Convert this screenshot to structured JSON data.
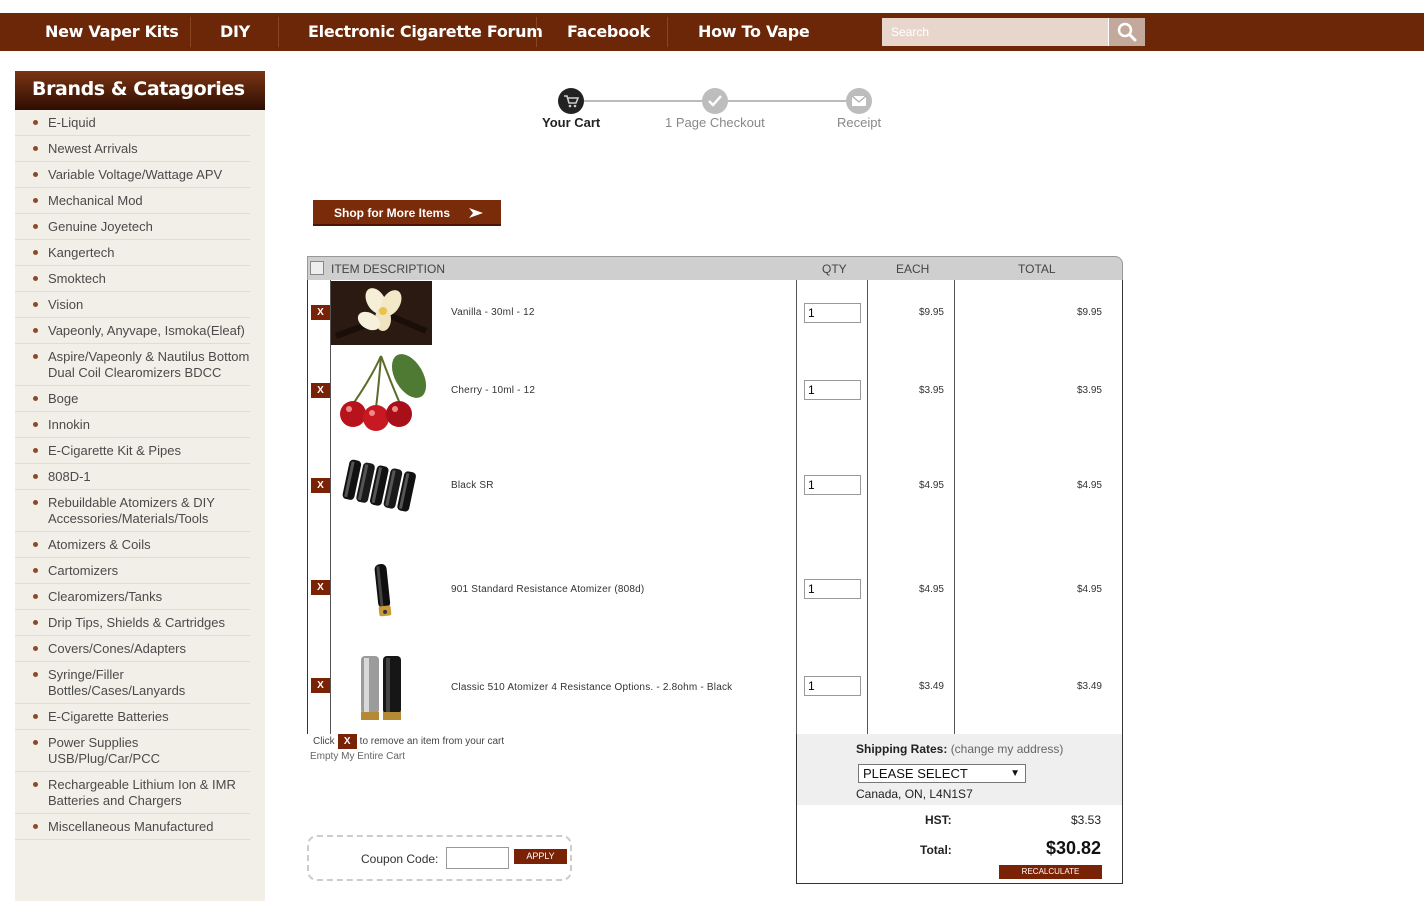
{
  "nav": {
    "items": [
      "New Vaper Kits",
      "DIY",
      "Electronic Cigarette Forum",
      "Facebook",
      "How To Vape"
    ],
    "search_placeholder": "Search"
  },
  "sidebar": {
    "title": "Brands & Catagories",
    "categories": [
      "E-Liquid",
      "Newest Arrivals",
      "Variable Voltage/Wattage APV",
      "Mechanical Mod",
      "Genuine Joyetech",
      "Kangertech",
      "Smoktech",
      "Vision",
      "Vapeonly, Anyvape, Ismoka(Eleaf)",
      "Aspire/Vapeonly & Nautilus Bottom Dual Coil Clearomizers BDCC",
      "Boge",
      "Innokin",
      "E-Cigarette Kit & Pipes",
      "808D-1",
      "Rebuildable Atomizers & DIY Accessories/Materials/Tools",
      "Atomizers & Coils",
      "Cartomizers",
      "Clearomizers/Tanks",
      "Drip Tips, Shields & Cartridges",
      "Covers/Cones/Adapters",
      "Syringe/Filler Bottles/Cases/Lanyards",
      "E-Cigarette Batteries",
      "Power Supplies USB/Plug/Car/PCC",
      "Rechargeable Lithium Ion & IMR Batteries and Chargers",
      "Miscellaneous Manufactured"
    ]
  },
  "steps": [
    "Your Cart",
    "1 Page Checkout",
    "Receipt"
  ],
  "shop_button": "Shop for More Items",
  "cart": {
    "headers": {
      "description": "ITEM  DESCRIPTION",
      "qty": "QTY",
      "each": "EACH",
      "total": "TOTAL"
    },
    "remove_label": "X",
    "items": [
      {
        "name": "Vanilla - 30ml - 12",
        "qty": "1",
        "each": "$9.95",
        "total": "$9.95"
      },
      {
        "name": "Cherry - 10ml - 12",
        "qty": "1",
        "each": "$3.95",
        "total": "$3.95"
      },
      {
        "name": "Black SR",
        "qty": "1",
        "each": "$4.95",
        "total": "$4.95"
      },
      {
        "name": "901 Standard Resistance Atomizer (808d)",
        "qty": "1",
        "each": "$4.95",
        "total": "$4.95"
      },
      {
        "name": "Classic 510 Atomizer 4 Resistance Options. - 2.8ohm - Black",
        "qty": "1",
        "each": "$3.49",
        "total": "$3.49"
      }
    ],
    "note_before": "Click",
    "note_after": "to remove an item from your cart",
    "empty_link": "Empty My Entire Cart"
  },
  "shipping": {
    "label": "Shipping Rates:",
    "change_link": "(change my address)",
    "select_value": "PLEASE SELECT",
    "address": "Canada, ON, L4N1S7"
  },
  "totals": {
    "hst_label": "HST:",
    "hst_value": "$3.53",
    "total_label": "Total:",
    "total_value": "$30.82",
    "recalc": "RECALCULATE"
  },
  "coupon": {
    "label": "Coupon Code:",
    "apply": "APPLY"
  },
  "colors": {
    "nav_bg": "#6b2708",
    "accent": "#7a2206"
  }
}
